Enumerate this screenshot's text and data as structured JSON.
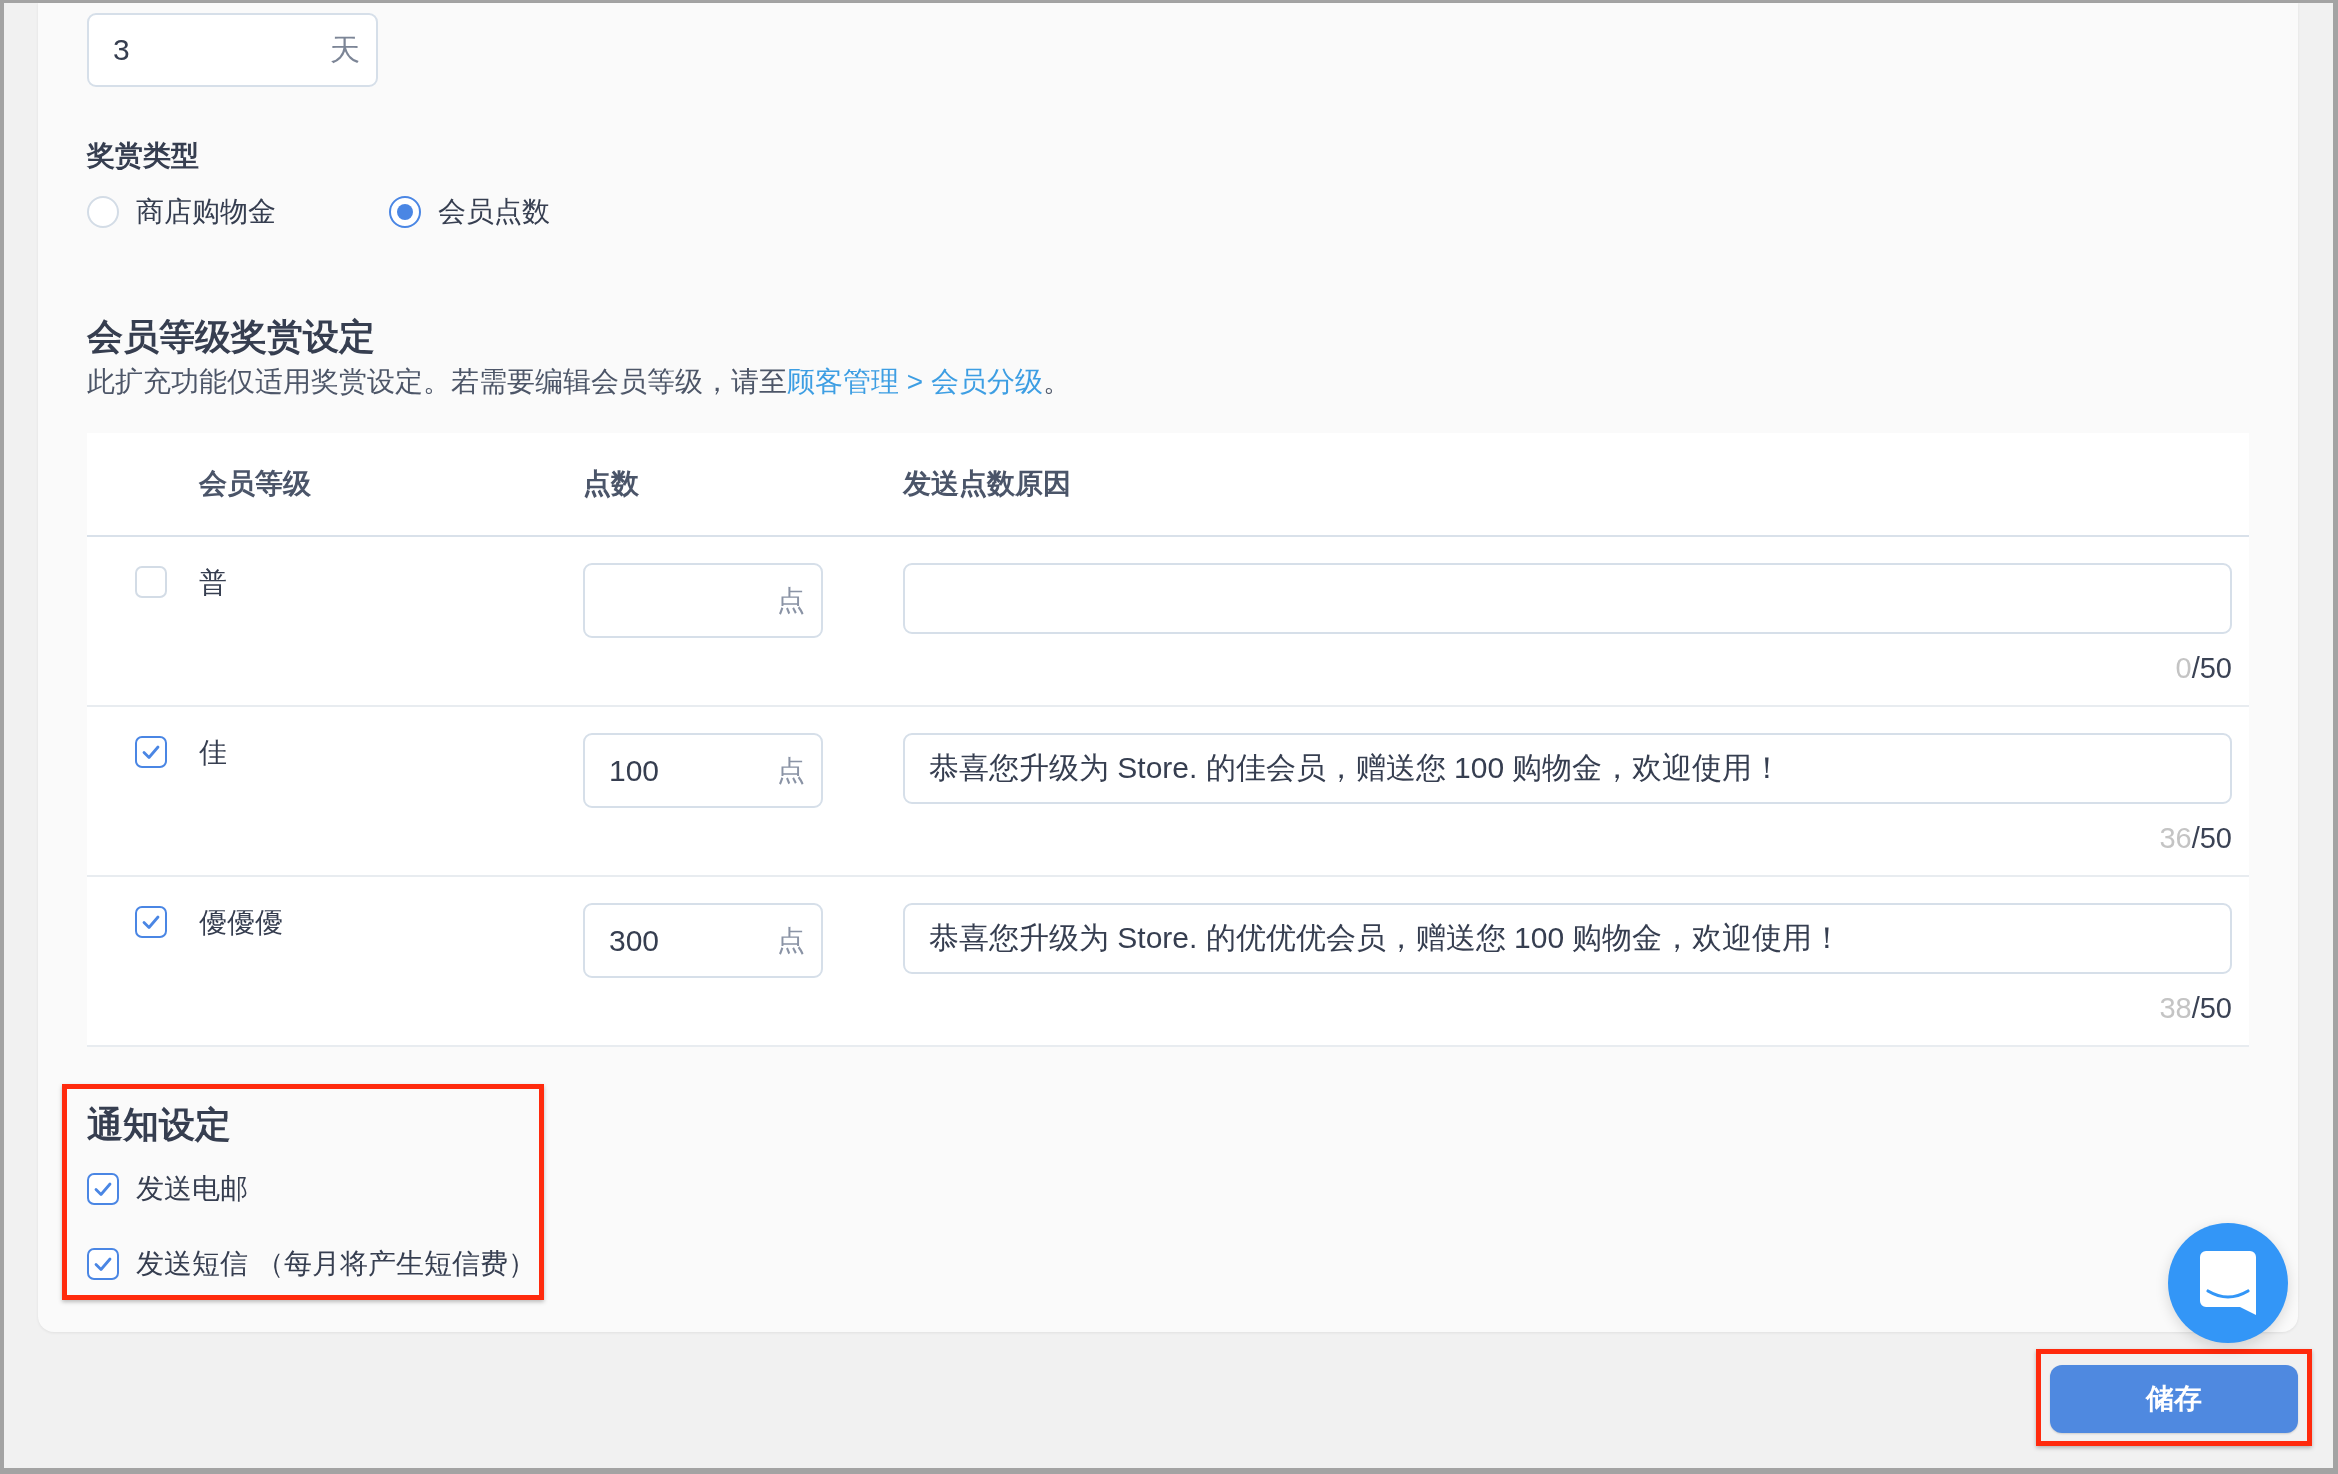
{
  "duration_field": {
    "value": "3",
    "unit": "天"
  },
  "reward_type": {
    "label": "奖赏类型",
    "options": [
      {
        "label": "商店购物金",
        "selected": false
      },
      {
        "label": "会员点数",
        "selected": true
      }
    ]
  },
  "tier_rewards": {
    "title": "会员等级奖赏设定",
    "description": "此扩充功能仅适用奖赏设定。若需要编辑会员等级，请至",
    "link": "顾客管理 > 会员分级",
    "description_end": "。",
    "columns": [
      "会员等级",
      "点数",
      "发送点数原因"
    ],
    "rows": [
      {
        "checked": false,
        "tier": "普",
        "unit": "点",
        "count": "0",
        "max": "/50"
      },
      {
        "checked": true,
        "tier": "佳",
        "points": "100",
        "unit": "点",
        "reason": "恭喜您升级为 Store. 的佳会员，赠送您 100 购物金，欢迎使用！",
        "count": "36",
        "max": "/50"
      },
      {
        "checked": true,
        "tier": "優優優",
        "points": "300",
        "unit": "点",
        "reason": "恭喜您升级为 Store. 的优优优会员，赠送您 100 购物金，欢迎使用！",
        "count": "38",
        "max": "/50"
      }
    ]
  },
  "notifications": {
    "title": "通知设定",
    "highlighted": true,
    "options": [
      {
        "label": "发送电邮",
        "checked": true
      },
      {
        "label": "发送短信 （每月将产生短信费）",
        "checked": true
      }
    ]
  },
  "save_button": {
    "label": "储存",
    "highlighted": true
  }
}
